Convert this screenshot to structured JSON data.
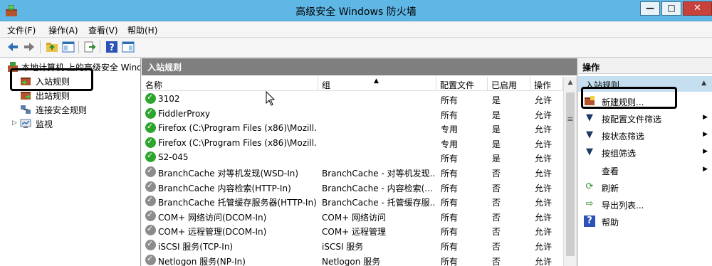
{
  "window": {
    "title": "高级安全 Windows 防火墙",
    "min_glyph": "—",
    "max_glyph": "□",
    "close_glyph": "✕"
  },
  "menubar": {
    "items": [
      "文件(F)",
      "操作(A)",
      "查看(V)",
      "帮助(H)"
    ]
  },
  "toolbar": {
    "buttons": [
      "back-icon",
      "forward-icon",
      "up-folder-icon",
      "show-hide-tree-icon",
      "export-icon",
      "help-icon",
      "show-hide-action-pane-icon"
    ]
  },
  "tree": {
    "root": "本地计算机 上的高级安全 Wind",
    "items": [
      "入站规则",
      "出站规则",
      "连接安全规则",
      "监视"
    ]
  },
  "center": {
    "header": "入站规则",
    "columns": [
      "名称",
      "组",
      "配置文件",
      "已启用",
      "操作"
    ],
    "rows": [
      {
        "name": "3102",
        "group": "",
        "profile": "所有",
        "enabled": "是",
        "action": "允许",
        "status": "on"
      },
      {
        "name": "FiddlerProxy",
        "group": "",
        "profile": "所有",
        "enabled": "是",
        "action": "允许",
        "status": "on"
      },
      {
        "name": "Firefox (C:\\Program Files (x86)\\Mozill...",
        "group": "",
        "profile": "专用",
        "enabled": "是",
        "action": "允许",
        "status": "on"
      },
      {
        "name": "Firefox (C:\\Program Files (x86)\\Mozill...",
        "group": "",
        "profile": "专用",
        "enabled": "是",
        "action": "允许",
        "status": "on"
      },
      {
        "name": "S2-045",
        "group": "",
        "profile": "所有",
        "enabled": "是",
        "action": "允许",
        "status": "on"
      },
      {
        "name": "BranchCache 对等机发现(WSD-In)",
        "group": "BranchCache - 对等机发现...",
        "profile": "所有",
        "enabled": "否",
        "action": "允许",
        "status": "off"
      },
      {
        "name": "BranchCache 内容检索(HTTP-In)",
        "group": "BranchCache - 内容检索(...",
        "profile": "所有",
        "enabled": "否",
        "action": "允许",
        "status": "off"
      },
      {
        "name": "BranchCache 托管缓存服务器(HTTP-In)",
        "group": "BranchCache - 托管缓存服...",
        "profile": "所有",
        "enabled": "否",
        "action": "允许",
        "status": "off"
      },
      {
        "name": "COM+ 网络访问(DCOM-In)",
        "group": "COM+ 网络访问",
        "profile": "所有",
        "enabled": "否",
        "action": "允许",
        "status": "off"
      },
      {
        "name": "COM+ 远程管理(DCOM-In)",
        "group": "COM+ 远程管理",
        "profile": "所有",
        "enabled": "否",
        "action": "允许",
        "status": "off"
      },
      {
        "name": "iSCSI 服务(TCP-In)",
        "group": "iSCSI 服务",
        "profile": "所有",
        "enabled": "否",
        "action": "允许",
        "status": "off"
      },
      {
        "name": "Netlogon 服务(NP-In)",
        "group": "Netlogon 服务",
        "profile": "所有",
        "enabled": "否",
        "action": "允许",
        "status": "off"
      }
    ]
  },
  "actions": {
    "header": "操作",
    "section": "入站规则",
    "items": [
      {
        "label": "新建规则...",
        "icon": "new-rule-icon",
        "submenu": false
      },
      {
        "label": "按配置文件筛选",
        "icon": "filter-icon",
        "submenu": true
      },
      {
        "label": "按状态筛选",
        "icon": "filter-icon",
        "submenu": true
      },
      {
        "label": "按组筛选",
        "icon": "filter-icon",
        "submenu": true
      },
      {
        "label": "查看",
        "icon": "",
        "submenu": true
      },
      {
        "label": "刷新",
        "icon": "refresh-icon",
        "submenu": false
      },
      {
        "label": "导出列表...",
        "icon": "export-list-icon",
        "submenu": false
      },
      {
        "label": "帮助",
        "icon": "help-icon",
        "submenu": false
      }
    ]
  },
  "colors": {
    "titlebar": "#5fb7e6",
    "pane_header": "#7f7f7f",
    "section_highlight": "#c5dff0",
    "enabled_green": "#2ca52c",
    "disabled_gray": "#8c8c8c"
  }
}
